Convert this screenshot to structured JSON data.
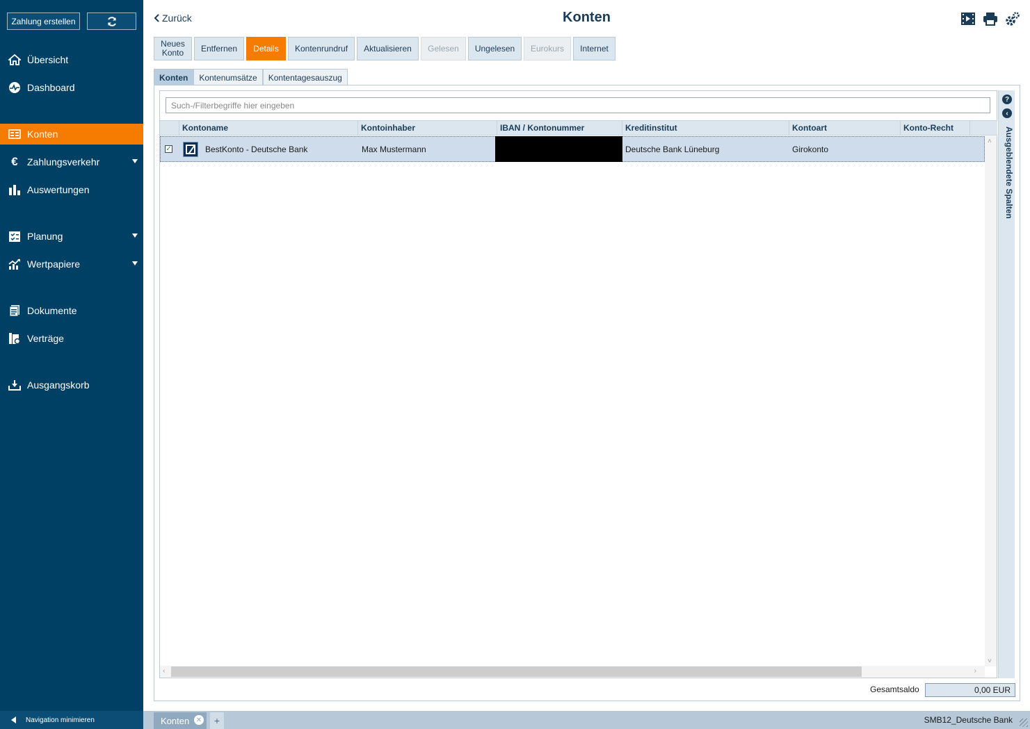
{
  "sidebar": {
    "create_payment_label": "Zahlung erstellen",
    "refresh_icon": "refresh-icon",
    "items": [
      {
        "label": "Übersicht",
        "icon": "home-icon"
      },
      {
        "label": "Dashboard",
        "icon": "dashboard-icon"
      },
      {
        "label": "Konten",
        "icon": "accounts-icon",
        "active": true
      },
      {
        "label": "Zahlungsverkehr",
        "icon": "euro-icon",
        "expandable": true
      },
      {
        "label": "Auswertungen",
        "icon": "bar-chart-icon"
      },
      {
        "label": "Planung",
        "icon": "planning-icon",
        "expandable": true
      },
      {
        "label": "Wertpapiere",
        "icon": "securities-chart-icon",
        "expandable": true
      },
      {
        "label": "Dokumente",
        "icon": "documents-icon"
      },
      {
        "label": "Verträge",
        "icon": "contracts-icon"
      },
      {
        "label": "Ausgangskorb",
        "icon": "outbox-icon"
      }
    ],
    "minimize_label": "Navigation minimieren"
  },
  "header": {
    "back_label": "Zurück",
    "title": "Konten",
    "icons": [
      "video-icon",
      "print-icon",
      "settings-icon"
    ]
  },
  "toolbar": {
    "buttons": [
      {
        "label": "Neues Konto",
        "state": "normal"
      },
      {
        "label": "Entfernen",
        "state": "normal"
      },
      {
        "label": "Details",
        "state": "active"
      },
      {
        "label": "Kontenrundruf",
        "state": "normal"
      },
      {
        "label": "Aktualisieren",
        "state": "normal"
      },
      {
        "label": "Gelesen",
        "state": "disabled"
      },
      {
        "label": "Ungelesen",
        "state": "normal"
      },
      {
        "label": "Eurokurs",
        "state": "disabled"
      },
      {
        "label": "Internet",
        "state": "normal"
      }
    ]
  },
  "tabs": [
    {
      "label": "Konten",
      "active": true
    },
    {
      "label": "Kontenumsätze",
      "active": false
    },
    {
      "label": "Kontentagesauszug",
      "active": false
    }
  ],
  "grid": {
    "search_placeholder": "Such-/Filterbegriffe hier eingeben",
    "columns": [
      "Kontoname",
      "Kontoinhaber",
      "IBAN / Kontonummer",
      "Kreditinstitut",
      "Kontoart",
      "Konto-Recht"
    ],
    "rows": [
      {
        "checked": true,
        "kontoname": "BestKonto - Deutsche Bank",
        "kontoinhaber": "Max Mustermann",
        "iban": "",
        "kreditinstitut": "Deutsche Bank Lüneburg",
        "kontoart": "Girokonto",
        "konto_recht": ""
      }
    ],
    "hidden_columns_label": "Ausgeblendete Spalten",
    "help_icon": "help-icon",
    "collapse_icon": "chevron-left-icon"
  },
  "totals": {
    "label": "Gesamtsaldo",
    "value": "0,00 EUR"
  },
  "bottombar": {
    "tab_label": "Konten",
    "add_label": "+",
    "status": "SMB12_Deutsche Bank"
  },
  "colors": {
    "sidebar_bg": "#004065",
    "accent": "#f57c00",
    "header_text": "#1a3c57"
  }
}
